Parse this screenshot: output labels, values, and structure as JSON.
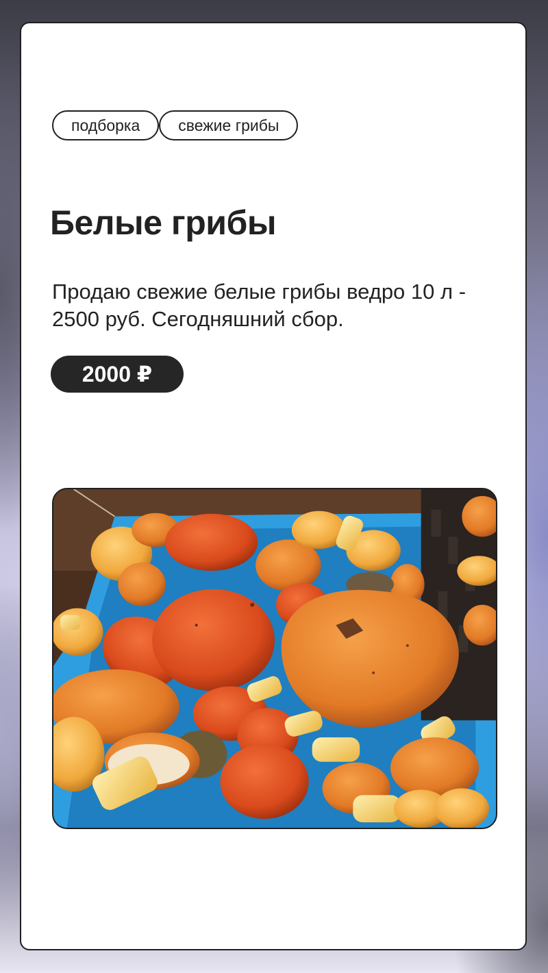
{
  "tags": [
    "подборка",
    "свежие грибы"
  ],
  "listing": {
    "title": "Белые грибы",
    "description": "Продаю свежие белые грибы ведро 10 л - 2500 руб. Сегодняшний сбор.",
    "price": "2000 ₽"
  },
  "photo": {
    "subject": "mushroom-basket-photo"
  }
}
